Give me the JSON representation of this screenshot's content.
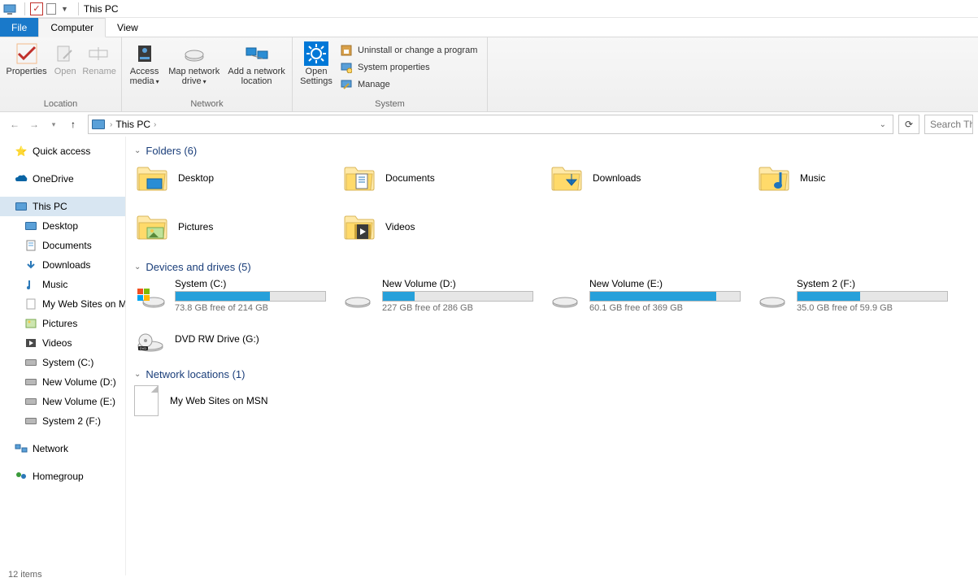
{
  "title": "This PC",
  "tabs": {
    "file": "File",
    "computer": "Computer",
    "view": "View"
  },
  "ribbon": {
    "location": {
      "label": "Location",
      "properties": "Properties",
      "open": "Open",
      "rename": "Rename"
    },
    "network": {
      "label": "Network",
      "access_media": "Access media",
      "map_drive": "Map network drive",
      "add_location": "Add a network location"
    },
    "system": {
      "label": "System",
      "open_settings": "Open Settings",
      "uninstall": "Uninstall or change a program",
      "sys_props": "System properties",
      "manage": "Manage"
    }
  },
  "address": {
    "crumb": "This PC"
  },
  "search_placeholder": "Search Th",
  "sidebar": {
    "quick_access": "Quick access",
    "onedrive": "OneDrive",
    "this_pc": "This PC",
    "children": [
      {
        "label": "Desktop",
        "icon": "desktop"
      },
      {
        "label": "Documents",
        "icon": "doc"
      },
      {
        "label": "Downloads",
        "icon": "down"
      },
      {
        "label": "Music",
        "icon": "music"
      },
      {
        "label": "My Web Sites on M",
        "icon": "file"
      },
      {
        "label": "Pictures",
        "icon": "pic"
      },
      {
        "label": "Videos",
        "icon": "vid"
      },
      {
        "label": "System (C:)",
        "icon": "hd"
      },
      {
        "label": "New Volume (D:)",
        "icon": "hd"
      },
      {
        "label": "New Volume (E:)",
        "icon": "hd"
      },
      {
        "label": "System 2 (F:)",
        "icon": "hd"
      }
    ],
    "network": "Network",
    "homegroup": "Homegroup"
  },
  "sections": {
    "folders_head": "Folders (6)",
    "drives_head": "Devices and drives (5)",
    "netloc_head": "Network locations (1)"
  },
  "folders": [
    {
      "label": "Desktop",
      "icon": "desktop"
    },
    {
      "label": "Documents",
      "icon": "doc"
    },
    {
      "label": "Downloads",
      "icon": "down"
    },
    {
      "label": "Music",
      "icon": "music"
    },
    {
      "label": "Pictures",
      "icon": "pic"
    },
    {
      "label": "Videos",
      "icon": "vid"
    }
  ],
  "drives": [
    {
      "label": "System (C:)",
      "free": "73.8 GB free of 214 GB",
      "pct": 63,
      "icon": "win"
    },
    {
      "label": "New Volume (D:)",
      "free": "227 GB free of 286 GB",
      "pct": 21,
      "icon": "hd"
    },
    {
      "label": "New Volume (E:)",
      "free": "60.1 GB free of 369 GB",
      "pct": 84,
      "icon": "hd"
    },
    {
      "label": "System 2 (F:)",
      "free": "35.0 GB free of 59.9 GB",
      "pct": 42,
      "icon": "hd"
    }
  ],
  "dvd": {
    "label": "DVD RW Drive (G:)"
  },
  "netloc": {
    "label": "My Web Sites on MSN"
  },
  "status": "12 items"
}
